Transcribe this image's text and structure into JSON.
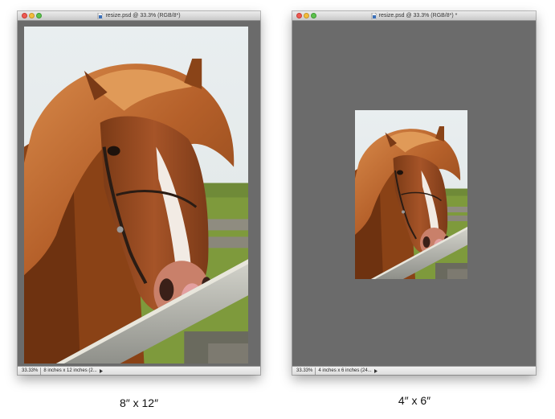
{
  "windows": [
    {
      "title": "resize.psd @ 33.3% (RGB/8*)",
      "zoom": "33.33%",
      "doc_info": "8 inches x 12 inches (2..."
    },
    {
      "title": "resize.psd @ 33.3% (RGB/8*) *",
      "zoom": "33.33%",
      "doc_info": "4 inches x 6 inches (24..."
    }
  ],
  "captions": {
    "left": "8″ x 12″",
    "right": "4″ x 6″"
  },
  "icons": {
    "doc": "photoshop-document-icon",
    "status_menu": "status-menu-arrow-icon"
  },
  "colors": {
    "canvas": "#6b6b6b",
    "close": "#ee5a53",
    "minimize": "#f3bd3a",
    "maximize": "#5dc24d"
  }
}
